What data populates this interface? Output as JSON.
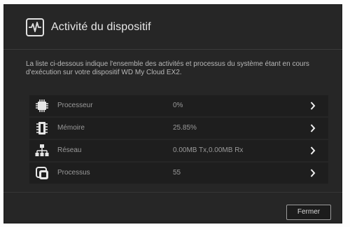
{
  "dialog": {
    "title": "Activité du dispositif",
    "title_icon": "activity-monitor-icon",
    "description": "La liste ci-dessous indique l'ensemble des activités et processus du système étant en cours d'exécution sur votre dispositif WD My Cloud EX2.",
    "rows": [
      {
        "label": "Processeur",
        "value": "0%",
        "icon": "cpu-chip-icon"
      },
      {
        "label": "Mémoire",
        "value": "25.85%",
        "icon": "memory-module-icon"
      },
      {
        "label": "Réseau",
        "value": "0.00MB Tx,0.00MB Rx",
        "icon": "network-icon"
      },
      {
        "label": "Processus",
        "value": "55",
        "icon": "processes-icon"
      }
    ],
    "close_label": "Fermer"
  }
}
